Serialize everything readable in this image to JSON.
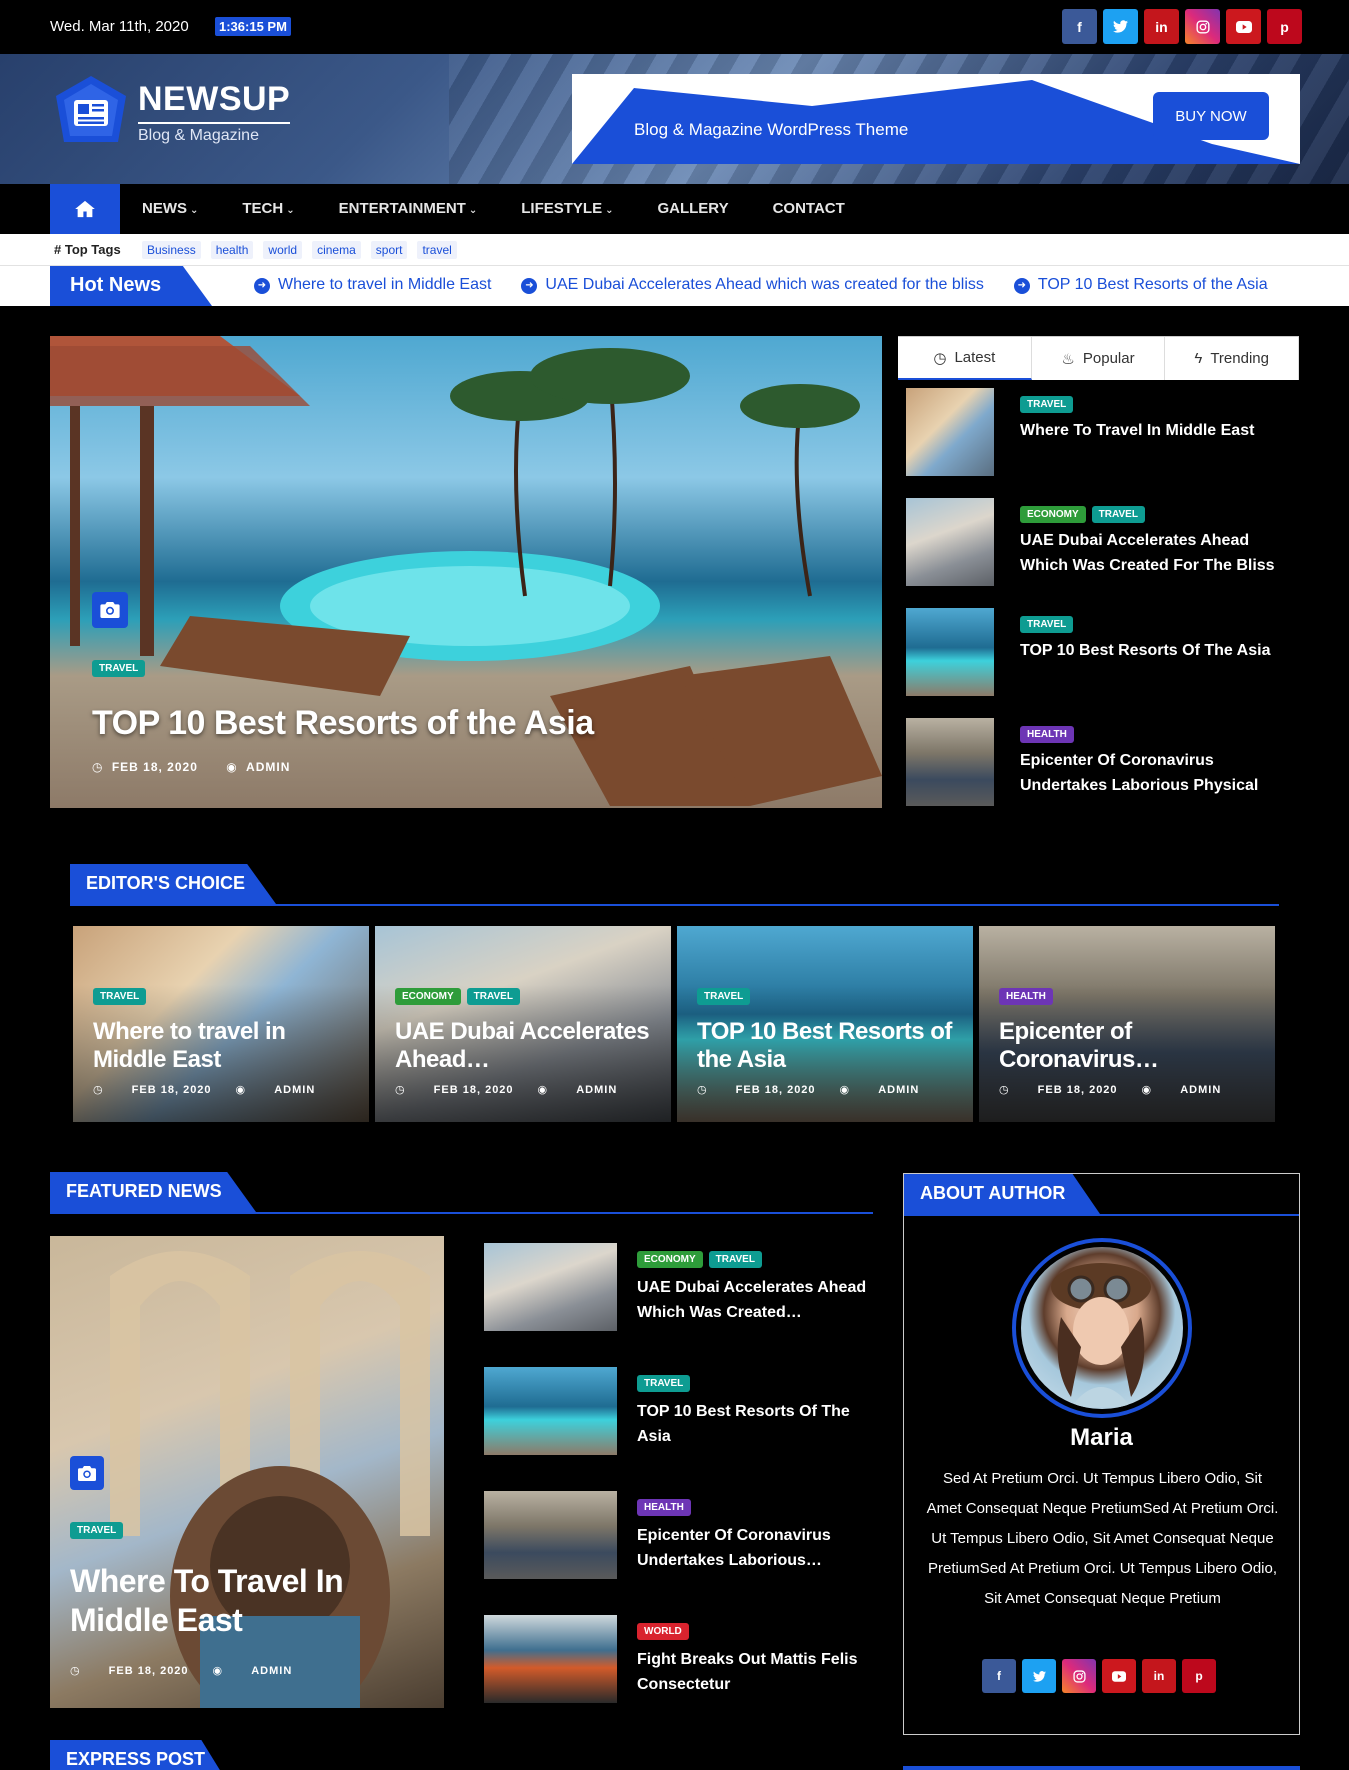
{
  "topbar": {
    "date": "Wed. Mar 11th, 2020",
    "time": "1:36:15 PM"
  },
  "social": [
    {
      "icon": "facebook-icon",
      "glyph": "f",
      "color": "#3b5998"
    },
    {
      "icon": "twitter-icon",
      "glyph": "t",
      "color": "#1da1f2"
    },
    {
      "icon": "linkedin-icon",
      "glyph": "in",
      "color": "#c4161c"
    },
    {
      "icon": "instagram-icon",
      "glyph": "◎",
      "color": "#dd2a7b"
    },
    {
      "icon": "youtube-icon",
      "glyph": "▶",
      "color": "#cc181e"
    },
    {
      "icon": "pinterest-icon",
      "glyph": "p",
      "color": "#bd081c"
    }
  ],
  "header": {
    "logo_title": "NEWSUP",
    "logo_sub": "Blog & Magazine",
    "ad_text": "Blog & Magazine WordPress Theme",
    "ad_button": "BUY NOW"
  },
  "nav": {
    "items": [
      {
        "label": "NEWS",
        "dropdown": true
      },
      {
        "label": "TECH",
        "dropdown": true
      },
      {
        "label": "ENTERTAINMENT",
        "dropdown": true
      },
      {
        "label": "LIFESTYLE",
        "dropdown": true
      },
      {
        "label": "GALLERY",
        "dropdown": false
      },
      {
        "label": "CONTACT",
        "dropdown": false
      }
    ]
  },
  "top_tags": {
    "label": "# Top Tags",
    "tags": [
      "Business",
      "health",
      "world",
      "cinema",
      "sport",
      "travel"
    ]
  },
  "hot_news": {
    "label": "Hot News",
    "items": [
      "Where to travel in Middle East",
      "UAE Dubai Accelerates Ahead which was created for the bliss",
      "TOP 10 Best Resorts of the Asia"
    ]
  },
  "hero": {
    "category": "TRAVEL",
    "title": "TOP 10 Best Resorts of the Asia",
    "date": "FEB 18, 2020",
    "author": "ADMIN"
  },
  "side_tabs": {
    "tabs": [
      "Latest",
      "Popular",
      "Trending"
    ],
    "items": [
      {
        "categories": [
          "TRAVEL"
        ],
        "title": "Where To Travel In Middle East"
      },
      {
        "categories": [
          "ECONOMY",
          "TRAVEL"
        ],
        "title": "UAE Dubai Accelerates Ahead Which Was Created For The Bliss"
      },
      {
        "categories": [
          "TRAVEL"
        ],
        "title": "TOP 10 Best Resorts Of The Asia"
      },
      {
        "categories": [
          "HEALTH"
        ],
        "title": "Epicenter Of Coronavirus Undertakes Laborious Physical"
      }
    ]
  },
  "editors_choice": {
    "heading": "EDITOR'S CHOICE",
    "cards": [
      {
        "categories": [
          "TRAVEL"
        ],
        "title": "Where to travel in Middle East",
        "date": "FEB 18, 2020",
        "author": "ADMIN"
      },
      {
        "categories": [
          "ECONOMY",
          "TRAVEL"
        ],
        "title": "UAE Dubai Accelerates Ahead…",
        "date": "FEB 18, 2020",
        "author": "ADMIN"
      },
      {
        "categories": [
          "TRAVEL"
        ],
        "title": "TOP 10 Best Resorts of the Asia",
        "date": "FEB 18, 2020",
        "author": "ADMIN"
      },
      {
        "categories": [
          "HEALTH"
        ],
        "title": "Epicenter of Coronavirus…",
        "date": "FEB 18, 2020",
        "author": "ADMIN"
      }
    ]
  },
  "featured": {
    "heading": "FEATURED NEWS",
    "main": {
      "category": "TRAVEL",
      "title": "Where To Travel In Middle East",
      "date": "FEB 18, 2020",
      "author": "ADMIN"
    },
    "items": [
      {
        "categories": [
          "ECONOMY",
          "TRAVEL"
        ],
        "title": "UAE Dubai Accelerates Ahead Which Was Created…"
      },
      {
        "categories": [
          "TRAVEL"
        ],
        "title": "TOP 10 Best Resorts Of The Asia"
      },
      {
        "categories": [
          "HEALTH"
        ],
        "title": "Epicenter Of Coronavirus Undertakes Laborious…"
      },
      {
        "categories": [
          "WORLD"
        ],
        "title": "Fight Breaks Out Mattis Felis Consectetur"
      }
    ]
  },
  "about": {
    "heading": "ABOUT AUTHOR",
    "name": "Maria",
    "bio": "Sed At Pretium Orci. Ut Tempus Libero Odio, Sit Amet Consequat Neque PretiumSed At Pretium Orci. Ut Tempus Libero Odio, Sit Amet Consequat Neque PretiumSed At Pretium Orci. Ut Tempus Libero Odio, Sit Amet Consequat Neque Pretium"
  },
  "express": {
    "heading": "EXPRESS POST"
  }
}
